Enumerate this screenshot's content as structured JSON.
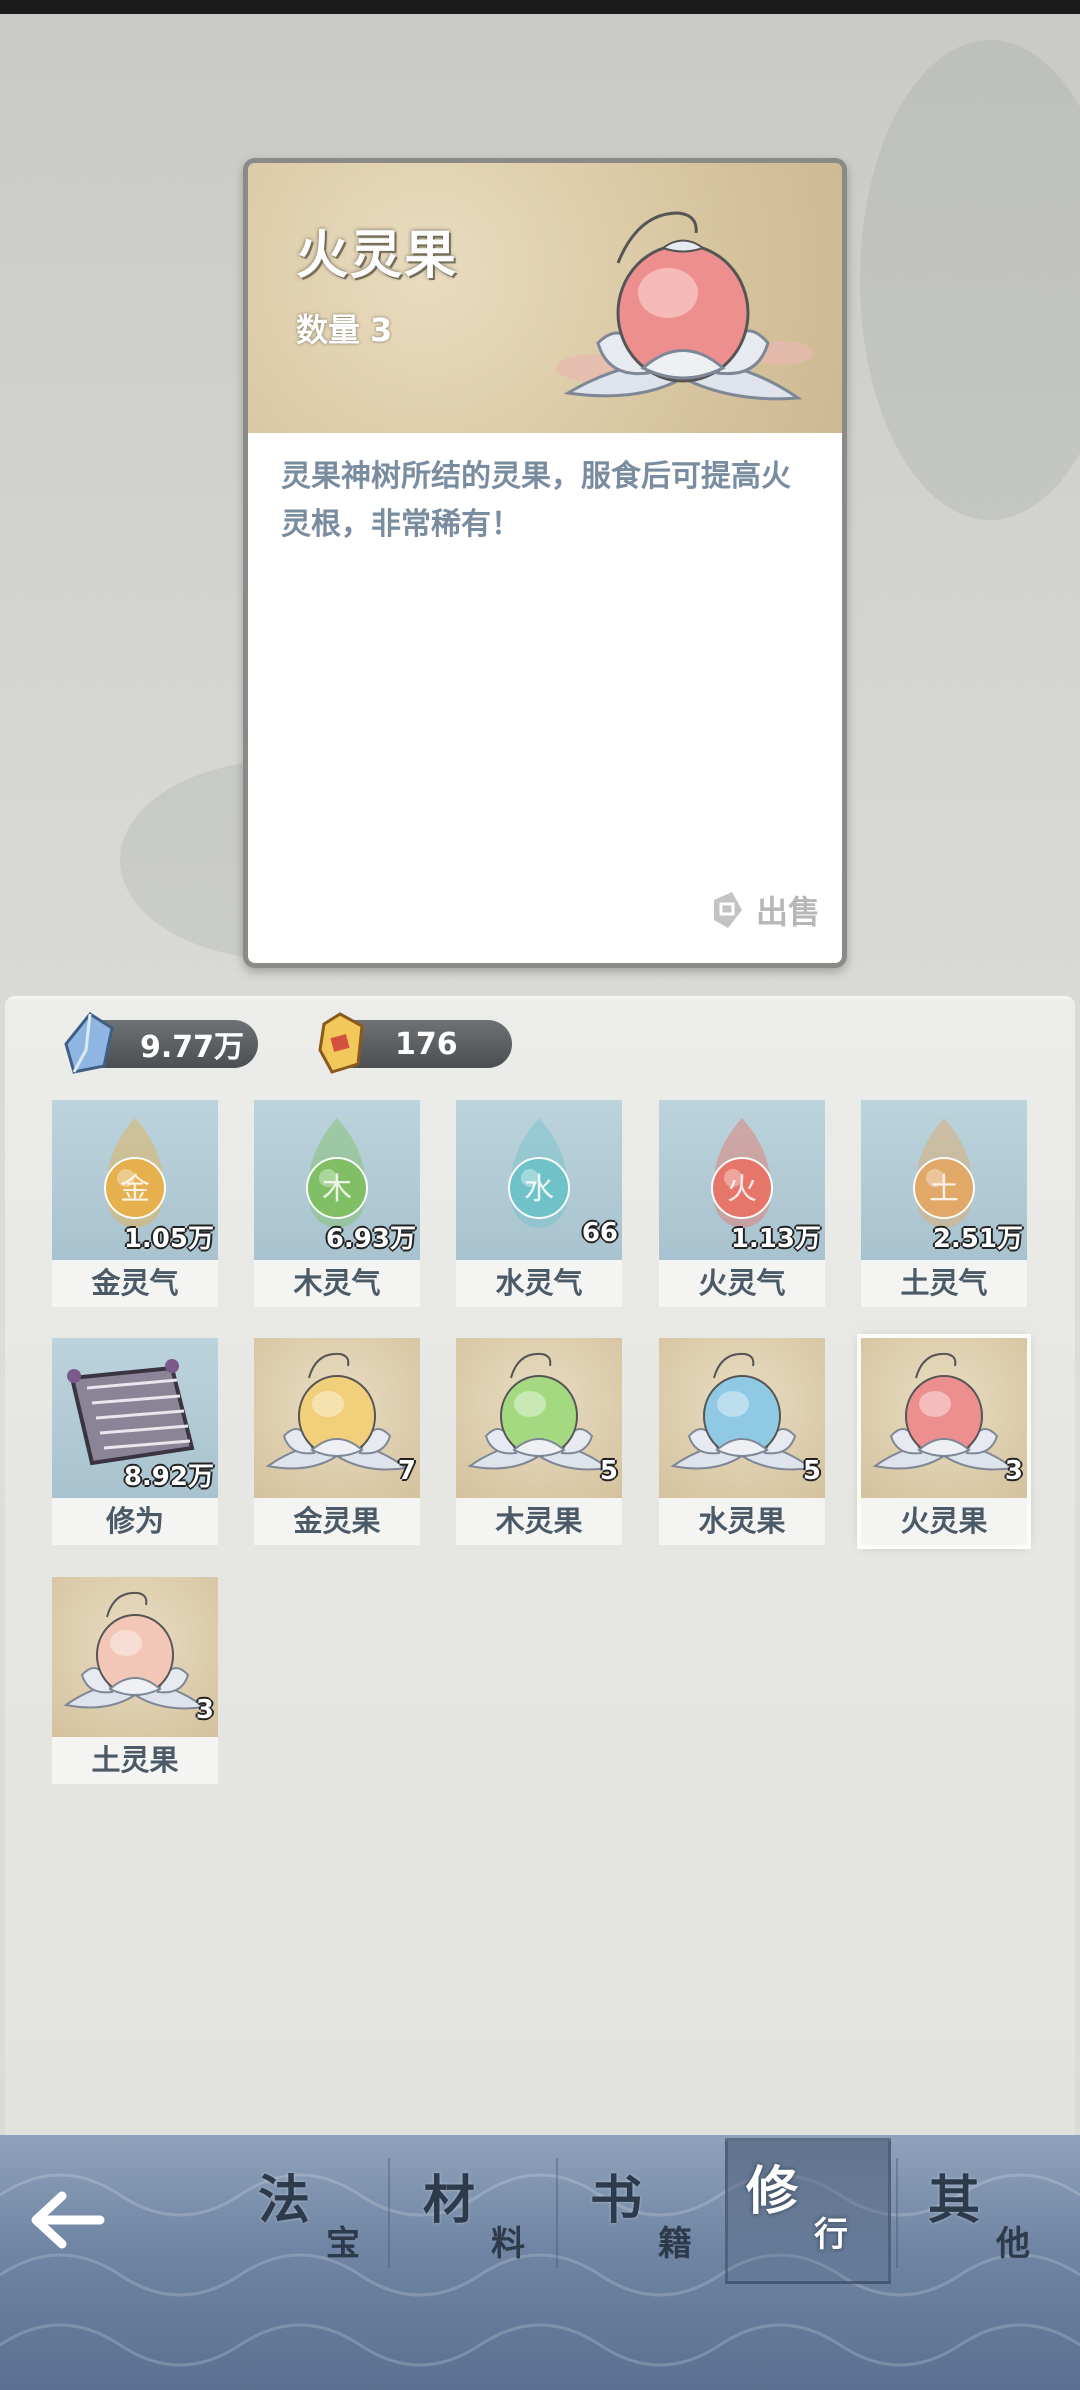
{
  "detail": {
    "name": "火灵果",
    "quantity_label": "数量",
    "quantity": "3",
    "description": "灵果神树所结的灵果，服食后可提高火灵根，非常稀有！",
    "sell_label": "出售"
  },
  "currencies": [
    {
      "icon": "blue-crystal-icon",
      "value": "9.77万"
    },
    {
      "icon": "gold-gem-icon",
      "value": "176"
    }
  ],
  "items": [
    {
      "label": "金灵气",
      "count": "1.05万",
      "glyph": "金",
      "color": "#e7b04a",
      "kind": "qi"
    },
    {
      "label": "木灵气",
      "count": "6.93万",
      "glyph": "木",
      "color": "#7fbf62",
      "kind": "qi"
    },
    {
      "label": "水灵气",
      "count": "66",
      "glyph": "水",
      "color": "#6fc2c9",
      "kind": "qi"
    },
    {
      "label": "火灵气",
      "count": "1.13万",
      "glyph": "火",
      "color": "#e77466",
      "kind": "qi"
    },
    {
      "label": "土灵气",
      "count": "2.51万",
      "glyph": "土",
      "color": "#e3a865",
      "kind": "qi"
    },
    {
      "label": "修为",
      "count": "8.92万",
      "glyph": "",
      "color": "#7c7486",
      "kind": "scroll"
    },
    {
      "label": "金灵果",
      "count": "7",
      "glyph": "",
      "color": "#f1cf7b",
      "kind": "fruit"
    },
    {
      "label": "木灵果",
      "count": "5",
      "glyph": "",
      "color": "#a4d982",
      "kind": "fruit"
    },
    {
      "label": "水灵果",
      "count": "5",
      "glyph": "",
      "color": "#8fc9e3",
      "kind": "fruit"
    },
    {
      "label": "火灵果",
      "count": "3",
      "glyph": "",
      "color": "#ee8f8f",
      "kind": "fruit",
      "selected": true
    },
    {
      "label": "土灵果",
      "count": "3",
      "glyph": "",
      "color": "#f2c7b7",
      "kind": "fruit"
    }
  ],
  "nav": {
    "back_icon": "back-arrow-icon",
    "tabs": [
      {
        "big": "法",
        "small": "宝"
      },
      {
        "big": "材",
        "small": "料"
      },
      {
        "big": "书",
        "small": "籍"
      },
      {
        "big": "修",
        "small": "行",
        "active": true
      },
      {
        "big": "其",
        "small": "他"
      }
    ]
  }
}
